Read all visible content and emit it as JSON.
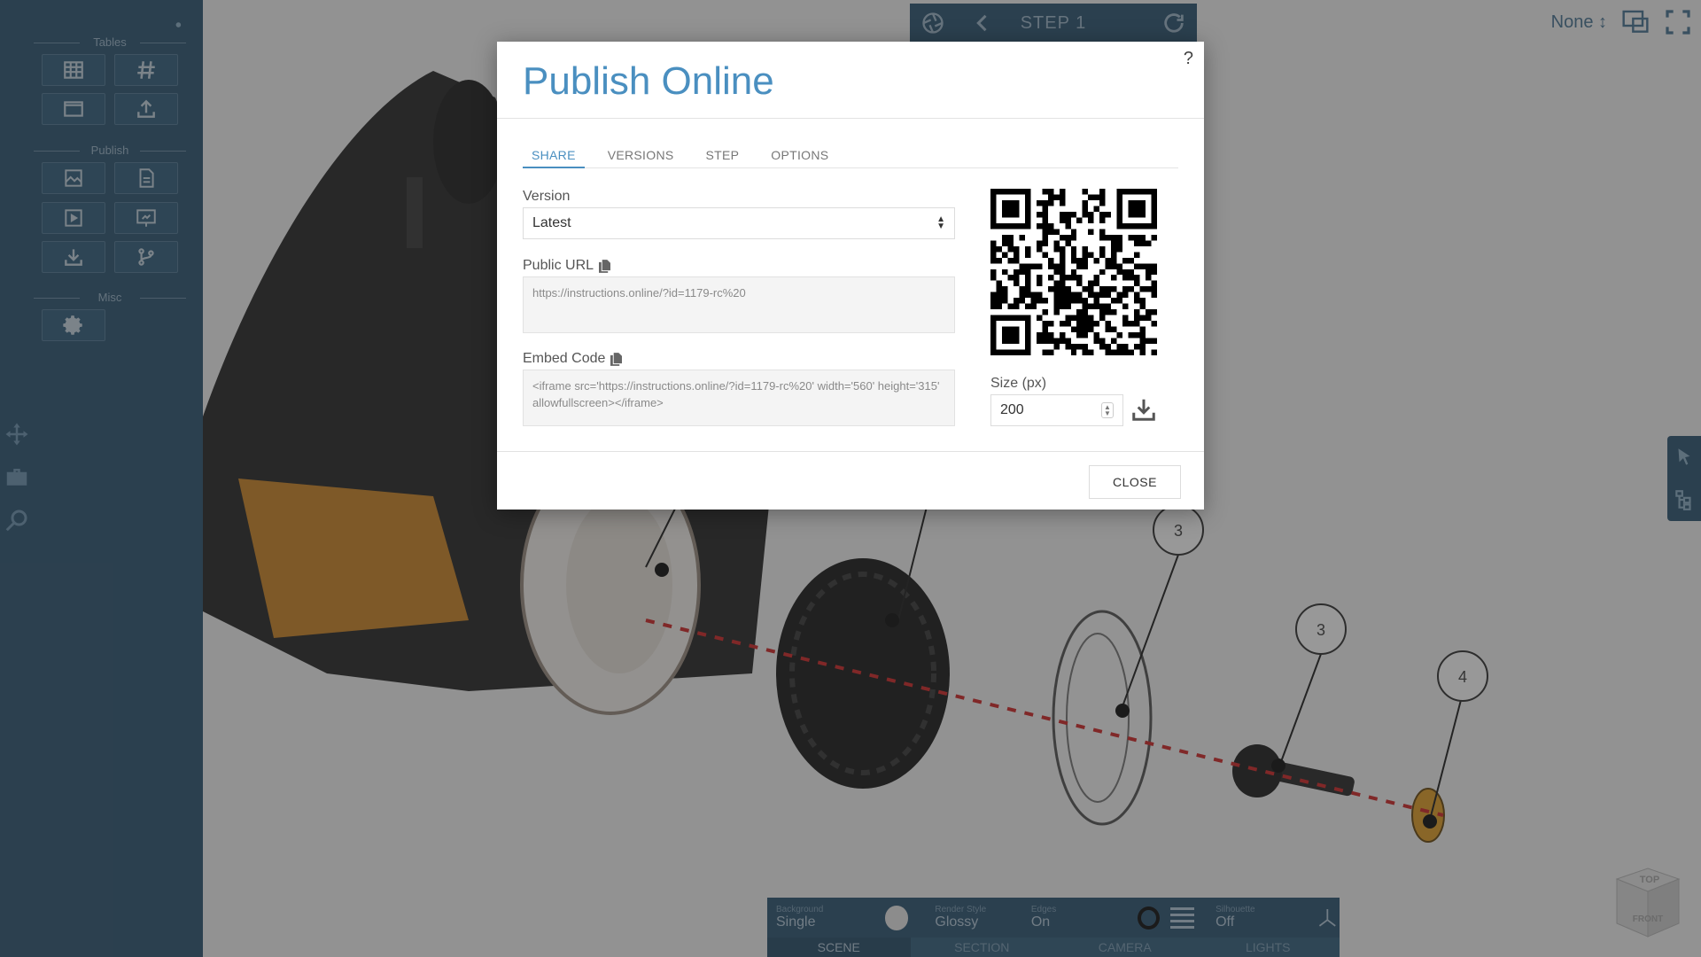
{
  "sidebar": {
    "groups": [
      {
        "label": "Tables"
      },
      {
        "label": "Publish"
      },
      {
        "label": "Misc"
      }
    ],
    "tools": {
      "tables": [
        "table-icon",
        "hash-icon",
        "window-icon",
        "upload-icon"
      ],
      "publish": [
        "image-export-icon",
        "pdf-export-icon",
        "video-export-icon",
        "presentation-export-icon",
        "download-icon",
        "branch-icon"
      ],
      "misc": [
        "settings-gear-icon"
      ]
    }
  },
  "toolbar": {
    "step_title": "STEP 1",
    "view_select": "None"
  },
  "bottom_panel": {
    "background": {
      "label": "Background",
      "value": "Single"
    },
    "render_style": {
      "label": "Render Style",
      "value": "Glossy"
    },
    "edges": {
      "label": "Edges",
      "value": "On"
    },
    "silhouette": {
      "label": "Silhouette",
      "value": "Off"
    },
    "tabs": [
      "SCENE",
      "SECTION",
      "CAMERA",
      "LIGHTS"
    ]
  },
  "scene": {
    "callouts": [
      "3",
      "3",
      "4"
    ],
    "viewcube": {
      "top": "TOP",
      "front": "FRONT"
    }
  },
  "dialog": {
    "title": "Publish Online",
    "help": "?",
    "tabs": [
      "SHARE",
      "VERSIONS",
      "STEP",
      "OPTIONS"
    ],
    "active_tab": "SHARE",
    "version": {
      "label": "Version",
      "value": "Latest"
    },
    "public_url": {
      "label": "Public URL",
      "value": "https://instructions.online/?id=1179-rc%20"
    },
    "embed_code": {
      "label": "Embed Code",
      "value": "<iframe src='https://instructions.online/?id=1179-rc%20' width='560' height='315' allowfullscreen></iframe>"
    },
    "size": {
      "label": "Size (px)",
      "value": "200"
    },
    "close_label": "CLOSE"
  },
  "colors": {
    "sidebar": "#2f5673",
    "accent": "#4a8fc0",
    "dashed_axis": "#d12a2a"
  }
}
